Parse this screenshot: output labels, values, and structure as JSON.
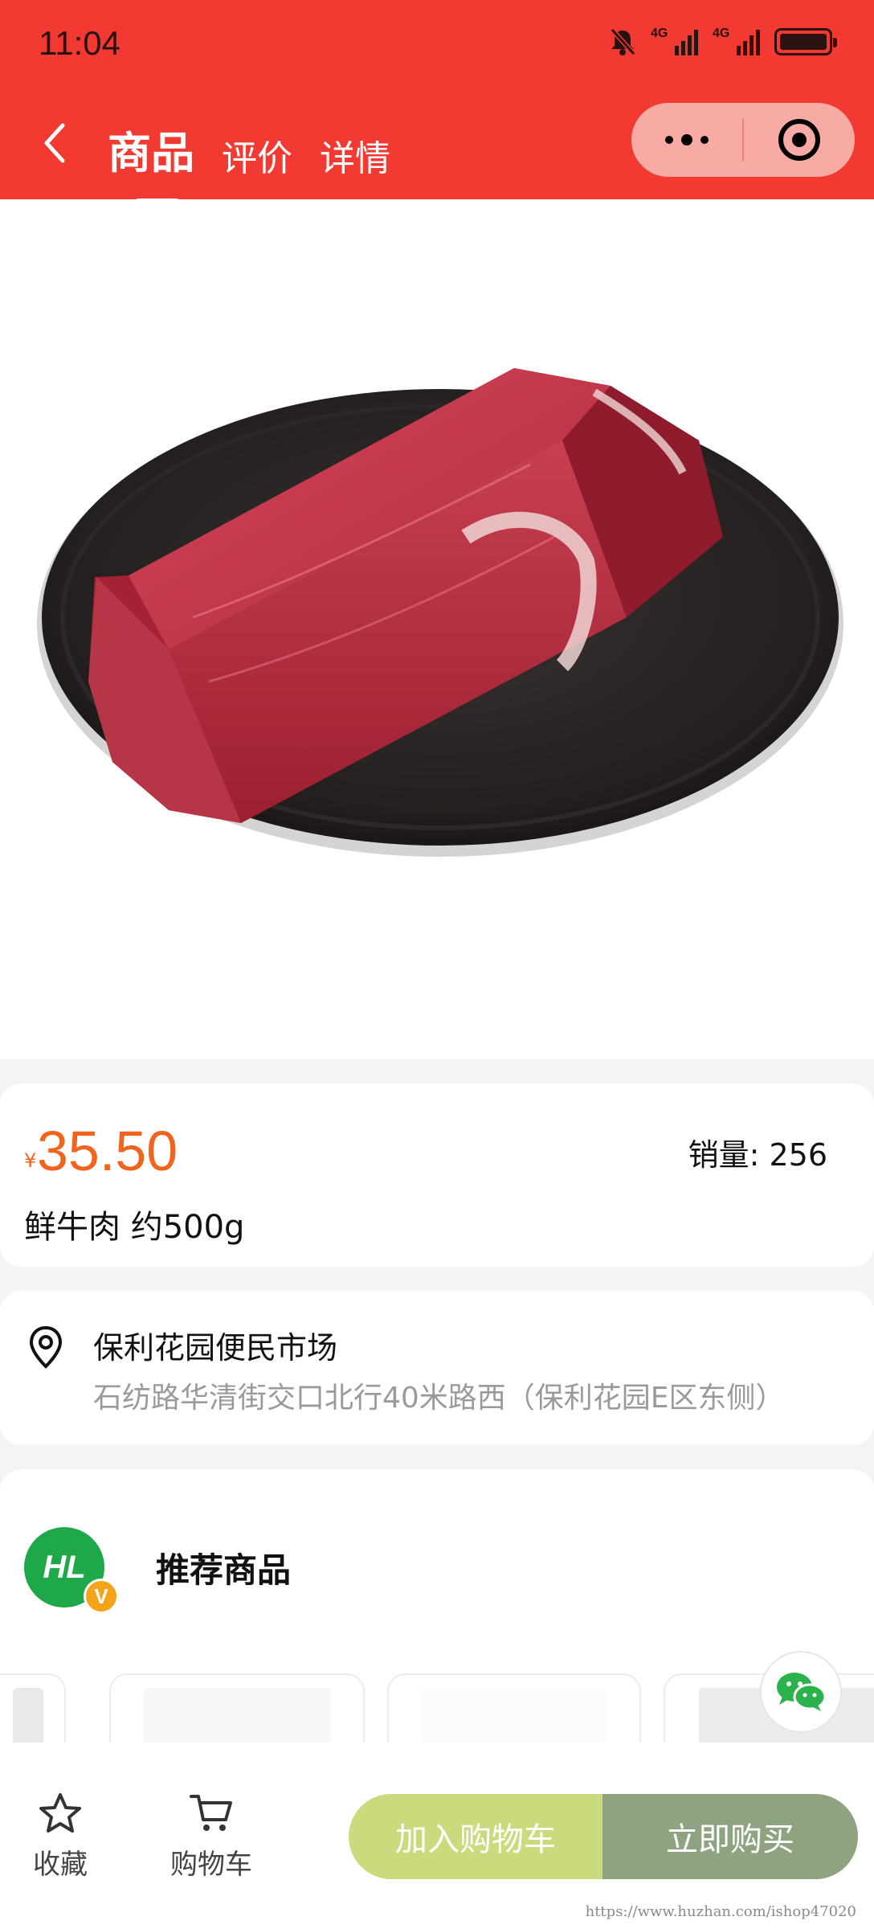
{
  "status_bar": {
    "time": "11:04",
    "net1": "4G",
    "net2": "4G"
  },
  "nav": {
    "tabs": [
      {
        "label": "商品",
        "active": true
      },
      {
        "label": "评价",
        "active": false
      },
      {
        "label": "详情",
        "active": false
      }
    ]
  },
  "product": {
    "currency_symbol": "¥",
    "price": "35.50",
    "sales": "销量: 256",
    "name": "鲜牛肉 约500g"
  },
  "store": {
    "name": "保利花园便民市场",
    "address": "石纺路华清街交口北行40米路西（保利花园E区东侧）"
  },
  "recommend": {
    "title": "推荐商品",
    "badge": "V",
    "logo_text": "HL"
  },
  "bottom_bar": {
    "favorite_label": "收藏",
    "cart_label": "购物车",
    "add_to_cart_label": "加入购物车",
    "buy_now_label": "立即购买"
  },
  "watermark": "https://www.huzhan.com/ishop47020",
  "colors": {
    "header": "#f33a32",
    "price": "#f0641e",
    "cart_btn": "#c9db7d",
    "buy_btn": "#8ea37f"
  }
}
